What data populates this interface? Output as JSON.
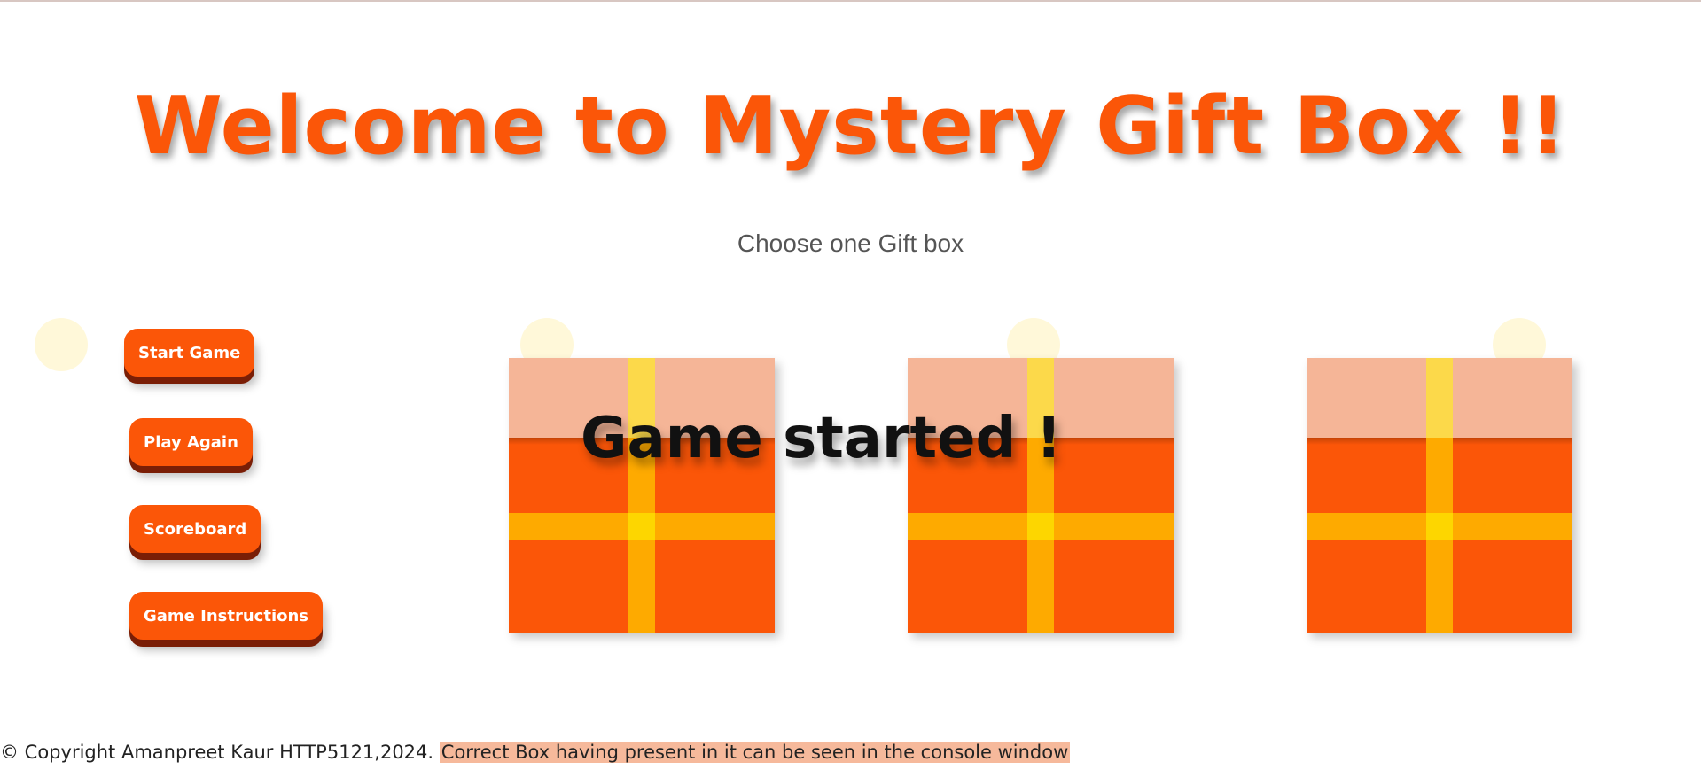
{
  "header": {
    "title": "Welcome to Mystery Gift Box !!",
    "subtitle": "Choose one Gift box"
  },
  "controls": {
    "start_label": "Start Game",
    "play_again_label": "Play Again",
    "scoreboard_label": "Scoreboard",
    "instructions_label": "Game Instructions"
  },
  "status_message": "Game started !",
  "footer": {
    "copyright": "© Copyright Amanpreet Kaur HTTP5121,2024.",
    "hint": "Correct Box having present in it can be seen in the console window"
  },
  "theme": {
    "accent": "#fb5608",
    "button_shadow": "#7a1e06",
    "gift_body": "#fb5608",
    "gift_lid": "#f5b597",
    "ribbon": "#feaa00",
    "ribbon_lid": "#fcd94a",
    "ribbon_knot": "#fdd600",
    "dot": "#fff8d9",
    "hint_highlight": "#f6b99b"
  },
  "gift_icon": "gift-box-icon"
}
